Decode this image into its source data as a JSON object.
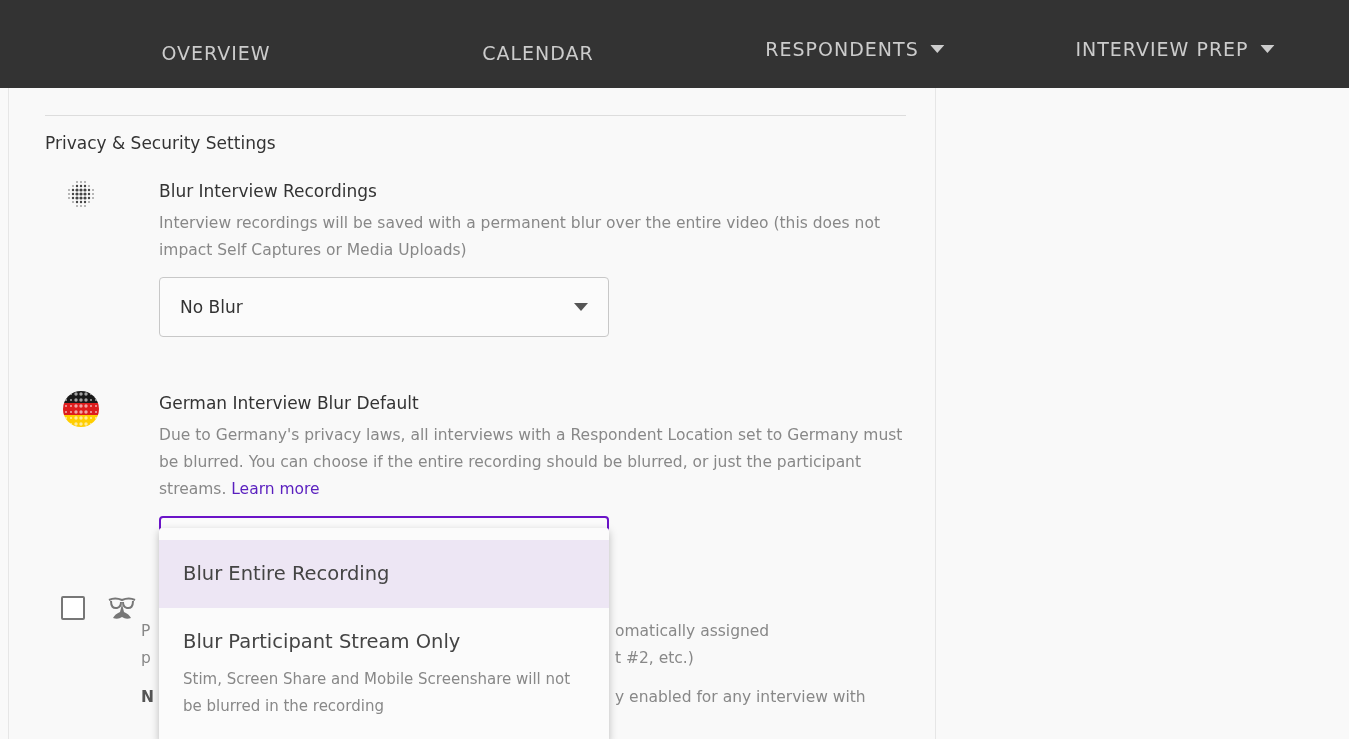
{
  "nav": {
    "items": [
      {
        "label": "OVERVIEW",
        "has_menu": false
      },
      {
        "label": "CALENDAR",
        "has_menu": false
      },
      {
        "label": "RESPONDENTS",
        "has_menu": true
      },
      {
        "label": "INTERVIEW PREP",
        "has_menu": true
      }
    ]
  },
  "section": {
    "title": "Privacy & Security Settings",
    "settings": [
      {
        "kind": "select",
        "title": "Blur Interview Recordings",
        "description": "Interview recordings will be saved with a permanent blur over the entire video (this does not impact Self Captures or Media Uploads)",
        "select": {
          "value": "No Blur",
          "open": false
        }
      },
      {
        "kind": "select",
        "title": "German Interview Blur Default",
        "description": "Due to Germany's privacy laws, all interviews with a Respondent Location set to Germany must be blurred. You can choose if the entire recording should be blurred, or just the participant streams.",
        "link": "Learn more",
        "select": {
          "open": true,
          "options": [
            {
              "label": "Blur Entire Recording",
              "selected": true
            },
            {
              "label": "Blur Participant Stream Only",
              "note": "Stim, Screen Share and Mobile Screenshare will not be blurred in the recording",
              "selected": false
            }
          ]
        }
      },
      {
        "kind": "checkbox",
        "checked": false,
        "lines": [
          {
            "left": "P",
            "right": "omatically assigned",
            "bold": false
          },
          {
            "left": "p",
            "right": "t #2, etc.)",
            "bold": false
          },
          {
            "left": "N",
            "right": "y enabled for any interview with",
            "bold": true
          }
        ]
      }
    ]
  }
}
